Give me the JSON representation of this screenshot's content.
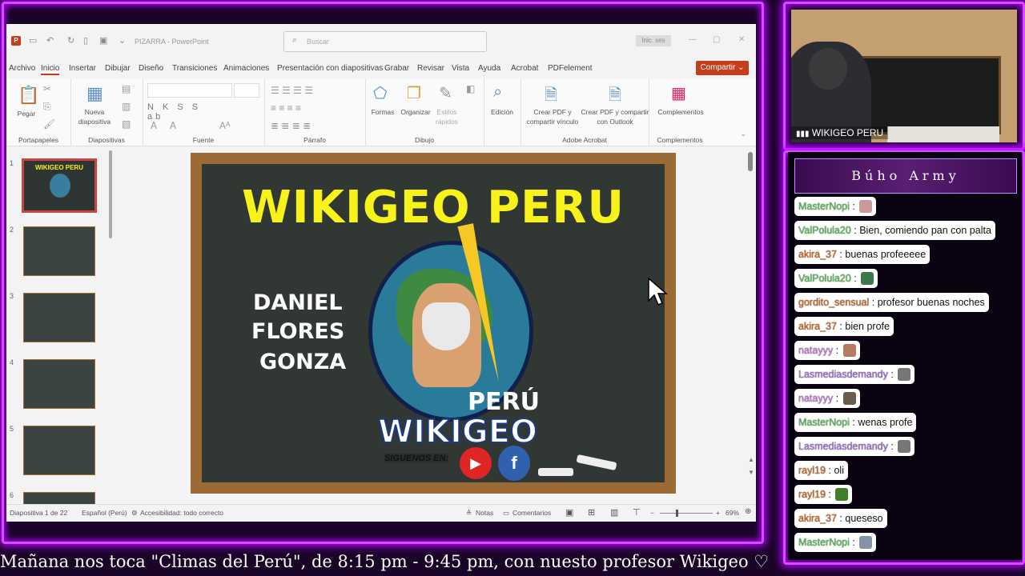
{
  "powerpoint": {
    "doc_title": "PIZARRA - PowerPoint",
    "search_placeholder": "Buscar",
    "signin": "Inic. ses",
    "share_label": "Compartir",
    "menu": [
      "Archivo",
      "Inicio",
      "Insertar",
      "Dibujar",
      "Diseño",
      "Transiciones",
      "Animaciones",
      "Presentación con diapositivas",
      "Grabar",
      "Revisar",
      "Vista",
      "Ayuda",
      "Acrobat",
      "PDFelement"
    ],
    "ribbon": {
      "paste": "Pegar",
      "new_slide": "Nueva\ndiapositiva",
      "group_portapapeles": "Portapapeles",
      "group_diapositivas": "Diapositivas",
      "group_fuente": "Fuente",
      "group_parrafo": "Párrafo",
      "group_dibujo": "Dibujo",
      "group_adobe": "Adobe Acrobat",
      "group_complementos": "Complementos",
      "formas": "Formas",
      "organizar": "Organizar",
      "estilos": "Estilos\nrápidos",
      "edicion": "Edición",
      "crear_pdf": "Crear PDF y\ncompartir vínculo",
      "crear_pdf_outlook": "Crear PDF y compartir\ncon Outlook",
      "complementos": "Complementos",
      "font_buttons": "N K S S ab"
    },
    "thumb_numbers": [
      "1",
      "2",
      "3",
      "4",
      "5",
      "6"
    ],
    "thumb1_title": "WIKIGEO PERU",
    "slide": {
      "title": "WIKIGEO PERU",
      "name_lines": [
        "DANIEL",
        "FLORES",
        "GONZA"
      ],
      "logo_text_top": "PERÚ",
      "logo_text_bottom": "WIKIGEO",
      "follow_text": "SIGUENOS EN:",
      "facebook_glyph": "f"
    },
    "status": {
      "slide_count": "Diapositiva 1 de 22",
      "language": "Español (Perú)",
      "accessibility": "Accesibilidad: todo correcto",
      "notes": "Notas",
      "comments": "Comentarios",
      "zoom": "69%"
    }
  },
  "webcam": {
    "label": "WIKIGEO PERU"
  },
  "chat": {
    "title": "Búho Army",
    "messages": [
      {
        "user": "MasterNopi",
        "text": "",
        "color": "#59c15a",
        "emote": "#c99"
      },
      {
        "user": "ValPolula20",
        "text": "Bien, comiendo pan con palta",
        "color": "#59c15a",
        "emote": ""
      },
      {
        "user": "akira_37",
        "text": "buenas profeeeee",
        "color": "#d46a1f",
        "emote": ""
      },
      {
        "user": "ValPolula20",
        "text": "",
        "color": "#59c15a",
        "emote": "#3a7a4a"
      },
      {
        "user": "gordito_sensual",
        "text": "profesor buenas noches",
        "color": "#d46a1f",
        "emote": ""
      },
      {
        "user": "akira_37",
        "text": "bien profe",
        "color": "#d46a1f",
        "emote": ""
      },
      {
        "user": "natayyy",
        "text": "",
        "color": "#c97ad6",
        "emote": "#b67a5c"
      },
      {
        "user": "Lasmediasdemandy",
        "text": "",
        "color": "#a66ee0",
        "emote": "#777"
      },
      {
        "user": "natayyy",
        "text": "",
        "color": "#c97ad6",
        "emote": "#6c5a4c"
      },
      {
        "user": "MasterNopi",
        "text": "wenas profe",
        "color": "#59c15a",
        "emote": ""
      },
      {
        "user": "Lasmediasdemandy",
        "text": "",
        "color": "#a66ee0",
        "emote": "#777"
      },
      {
        "user": "rayl19",
        "text": "oli",
        "color": "#d46a1f",
        "emote": ""
      },
      {
        "user": "rayl19",
        "text": "",
        "color": "#d46a1f",
        "emote": "#3f7f2a"
      },
      {
        "user": "akira_37",
        "text": "queseso",
        "color": "#d46a1f",
        "emote": ""
      },
      {
        "user": "MasterNopi",
        "text": "",
        "color": "#59c15a",
        "emote": "#8892a6"
      }
    ]
  },
  "ticker": "Mañana nos toca \"Climas del Perú\", de 8:15 pm - 9:45 pm, con nuesto profesor Wikigeo  ♡"
}
